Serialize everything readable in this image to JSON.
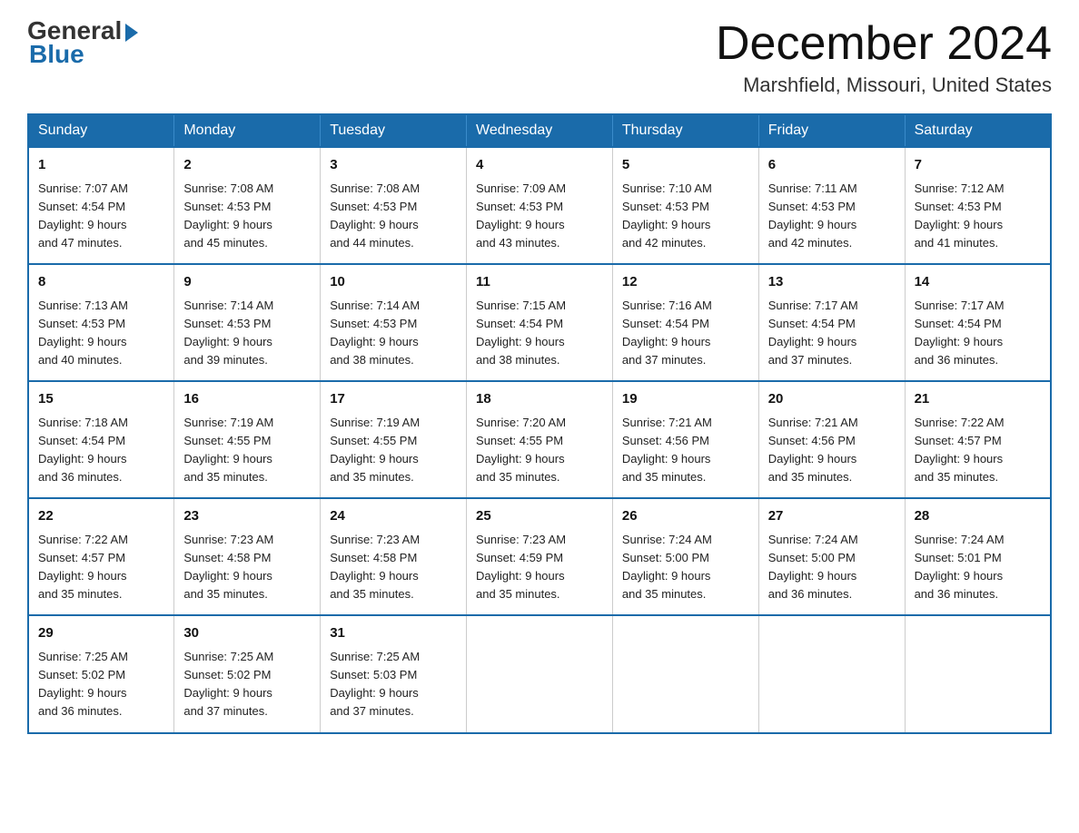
{
  "logo": {
    "general": "General",
    "blue": "Blue"
  },
  "title": "December 2024",
  "location": "Marshfield, Missouri, United States",
  "days_of_week": [
    "Sunday",
    "Monday",
    "Tuesday",
    "Wednesday",
    "Thursday",
    "Friday",
    "Saturday"
  ],
  "weeks": [
    [
      {
        "day": "1",
        "sunrise": "7:07 AM",
        "sunset": "4:54 PM",
        "daylight": "9 hours and 47 minutes."
      },
      {
        "day": "2",
        "sunrise": "7:08 AM",
        "sunset": "4:53 PM",
        "daylight": "9 hours and 45 minutes."
      },
      {
        "day": "3",
        "sunrise": "7:08 AM",
        "sunset": "4:53 PM",
        "daylight": "9 hours and 44 minutes."
      },
      {
        "day": "4",
        "sunrise": "7:09 AM",
        "sunset": "4:53 PM",
        "daylight": "9 hours and 43 minutes."
      },
      {
        "day": "5",
        "sunrise": "7:10 AM",
        "sunset": "4:53 PM",
        "daylight": "9 hours and 42 minutes."
      },
      {
        "day": "6",
        "sunrise": "7:11 AM",
        "sunset": "4:53 PM",
        "daylight": "9 hours and 42 minutes."
      },
      {
        "day": "7",
        "sunrise": "7:12 AM",
        "sunset": "4:53 PM",
        "daylight": "9 hours and 41 minutes."
      }
    ],
    [
      {
        "day": "8",
        "sunrise": "7:13 AM",
        "sunset": "4:53 PM",
        "daylight": "9 hours and 40 minutes."
      },
      {
        "day": "9",
        "sunrise": "7:14 AM",
        "sunset": "4:53 PM",
        "daylight": "9 hours and 39 minutes."
      },
      {
        "day": "10",
        "sunrise": "7:14 AM",
        "sunset": "4:53 PM",
        "daylight": "9 hours and 38 minutes."
      },
      {
        "day": "11",
        "sunrise": "7:15 AM",
        "sunset": "4:54 PM",
        "daylight": "9 hours and 38 minutes."
      },
      {
        "day": "12",
        "sunrise": "7:16 AM",
        "sunset": "4:54 PM",
        "daylight": "9 hours and 37 minutes."
      },
      {
        "day": "13",
        "sunrise": "7:17 AM",
        "sunset": "4:54 PM",
        "daylight": "9 hours and 37 minutes."
      },
      {
        "day": "14",
        "sunrise": "7:17 AM",
        "sunset": "4:54 PM",
        "daylight": "9 hours and 36 minutes."
      }
    ],
    [
      {
        "day": "15",
        "sunrise": "7:18 AM",
        "sunset": "4:54 PM",
        "daylight": "9 hours and 36 minutes."
      },
      {
        "day": "16",
        "sunrise": "7:19 AM",
        "sunset": "4:55 PM",
        "daylight": "9 hours and 35 minutes."
      },
      {
        "day": "17",
        "sunrise": "7:19 AM",
        "sunset": "4:55 PM",
        "daylight": "9 hours and 35 minutes."
      },
      {
        "day": "18",
        "sunrise": "7:20 AM",
        "sunset": "4:55 PM",
        "daylight": "9 hours and 35 minutes."
      },
      {
        "day": "19",
        "sunrise": "7:21 AM",
        "sunset": "4:56 PM",
        "daylight": "9 hours and 35 minutes."
      },
      {
        "day": "20",
        "sunrise": "7:21 AM",
        "sunset": "4:56 PM",
        "daylight": "9 hours and 35 minutes."
      },
      {
        "day": "21",
        "sunrise": "7:22 AM",
        "sunset": "4:57 PM",
        "daylight": "9 hours and 35 minutes."
      }
    ],
    [
      {
        "day": "22",
        "sunrise": "7:22 AM",
        "sunset": "4:57 PM",
        "daylight": "9 hours and 35 minutes."
      },
      {
        "day": "23",
        "sunrise": "7:23 AM",
        "sunset": "4:58 PM",
        "daylight": "9 hours and 35 minutes."
      },
      {
        "day": "24",
        "sunrise": "7:23 AM",
        "sunset": "4:58 PM",
        "daylight": "9 hours and 35 minutes."
      },
      {
        "day": "25",
        "sunrise": "7:23 AM",
        "sunset": "4:59 PM",
        "daylight": "9 hours and 35 minutes."
      },
      {
        "day": "26",
        "sunrise": "7:24 AM",
        "sunset": "5:00 PM",
        "daylight": "9 hours and 35 minutes."
      },
      {
        "day": "27",
        "sunrise": "7:24 AM",
        "sunset": "5:00 PM",
        "daylight": "9 hours and 36 minutes."
      },
      {
        "day": "28",
        "sunrise": "7:24 AM",
        "sunset": "5:01 PM",
        "daylight": "9 hours and 36 minutes."
      }
    ],
    [
      {
        "day": "29",
        "sunrise": "7:25 AM",
        "sunset": "5:02 PM",
        "daylight": "9 hours and 36 minutes."
      },
      {
        "day": "30",
        "sunrise": "7:25 AM",
        "sunset": "5:02 PM",
        "daylight": "9 hours and 37 minutes."
      },
      {
        "day": "31",
        "sunrise": "7:25 AM",
        "sunset": "5:03 PM",
        "daylight": "9 hours and 37 minutes."
      },
      null,
      null,
      null,
      null
    ]
  ],
  "labels": {
    "sunrise": "Sunrise:",
    "sunset": "Sunset:",
    "daylight": "Daylight:"
  }
}
